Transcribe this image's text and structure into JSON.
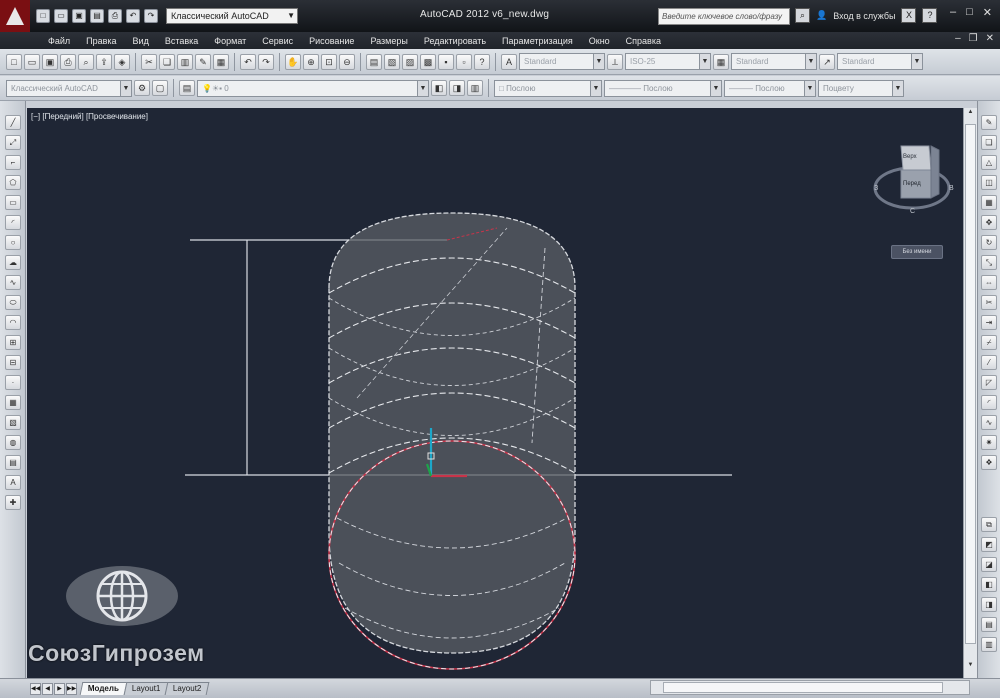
{
  "titlebar": {
    "workspace": "Классический AutoCAD",
    "title": "AutoCAD 2012    v6_new.dwg",
    "search_placeholder": "Введите ключевое слово/фразу",
    "signin": "Вход в службы"
  },
  "menu": {
    "items": [
      "Файл",
      "Правка",
      "Вид",
      "Вставка",
      "Формат",
      "Сервис",
      "Рисование",
      "Размеры",
      "Редактировать",
      "Параметризация",
      "Окно",
      "Справка"
    ]
  },
  "toolbar1": {
    "text_style": "Standard",
    "dim_style": "ISO-25",
    "table_style": "Standard",
    "mleader_style": "Standard"
  },
  "toolbar2": {
    "workspace": "Классический AutoCAD",
    "layer": "0",
    "color": "Послою",
    "linetype": "Послою",
    "lineweight": "Послою",
    "plotstyle": "Поцвету"
  },
  "viewport": {
    "label": "[−] [Передний] [Просвечивание]",
    "viewcube_top": "Верх",
    "viewcube_front": "Перед",
    "compass": {
      "w": "З",
      "e": "В",
      "s": "С"
    },
    "ucs_name": "Без имени"
  },
  "statusbar": {
    "tabs": [
      "Модель",
      "Layout1",
      "Layout2"
    ]
  },
  "watermark": "СоюзГипрозем",
  "colors": {
    "viewport_bg": "#1f2635",
    "title_bg": "#1b1e24",
    "red_accent": "#c8344a"
  }
}
